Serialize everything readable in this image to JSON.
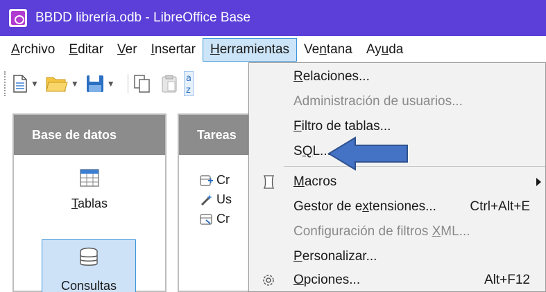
{
  "window": {
    "title": "BBDD librería.odb - LibreOffice Base"
  },
  "menubar": {
    "items": [
      {
        "pre": "",
        "ul": "A",
        "post": "rchivo"
      },
      {
        "pre": "",
        "ul": "E",
        "post": "ditar"
      },
      {
        "pre": "",
        "ul": "V",
        "post": "er"
      },
      {
        "pre": "",
        "ul": "I",
        "post": "nsertar"
      },
      {
        "pre": "",
        "ul": "H",
        "post": "erramientas"
      },
      {
        "pre": "Ve",
        "ul": "n",
        "post": "tana"
      },
      {
        "pre": "Ay",
        "ul": "u",
        "post": "da"
      }
    ]
  },
  "left_panel": {
    "header": "Base de datos",
    "tablas": {
      "ul": "T",
      "post": "ablas"
    },
    "consultas": {
      "label": "Consultas"
    }
  },
  "tasks_panel": {
    "header": "Tareas",
    "rows": [
      "Cr",
      "Us",
      "Cr"
    ]
  },
  "dropdown": {
    "relaciones": {
      "ul": "R",
      "post": "elaciones..."
    },
    "admin": {
      "label": "Administración de usuarios..."
    },
    "filtro": {
      "ul": "F",
      "post": "iltro de tablas..."
    },
    "sql": {
      "pre": "S",
      "ul": "Q",
      "post": "L..."
    },
    "macros": {
      "ul": "M",
      "post": "acros"
    },
    "gestor": {
      "pre": "Gestor de e",
      "ul": "x",
      "post": "tensiones...",
      "shortcut": "Ctrl+Alt+E"
    },
    "config": {
      "pre": "Configuración de filtros ",
      "ul": "X",
      "post": "ML..."
    },
    "personalizar": {
      "ul": "P",
      "post": "ersonalizar..."
    },
    "opciones": {
      "ul": "O",
      "post": "pciones...",
      "shortcut": "Alt+F12"
    }
  },
  "colors": {
    "titlebar": "#5b3fd8",
    "menu_highlight": "#cce4f7",
    "menu_highlight_border": "#3c94d8",
    "panel_header": "#8c8c8c",
    "annotation_arrow": "#4472c4"
  }
}
